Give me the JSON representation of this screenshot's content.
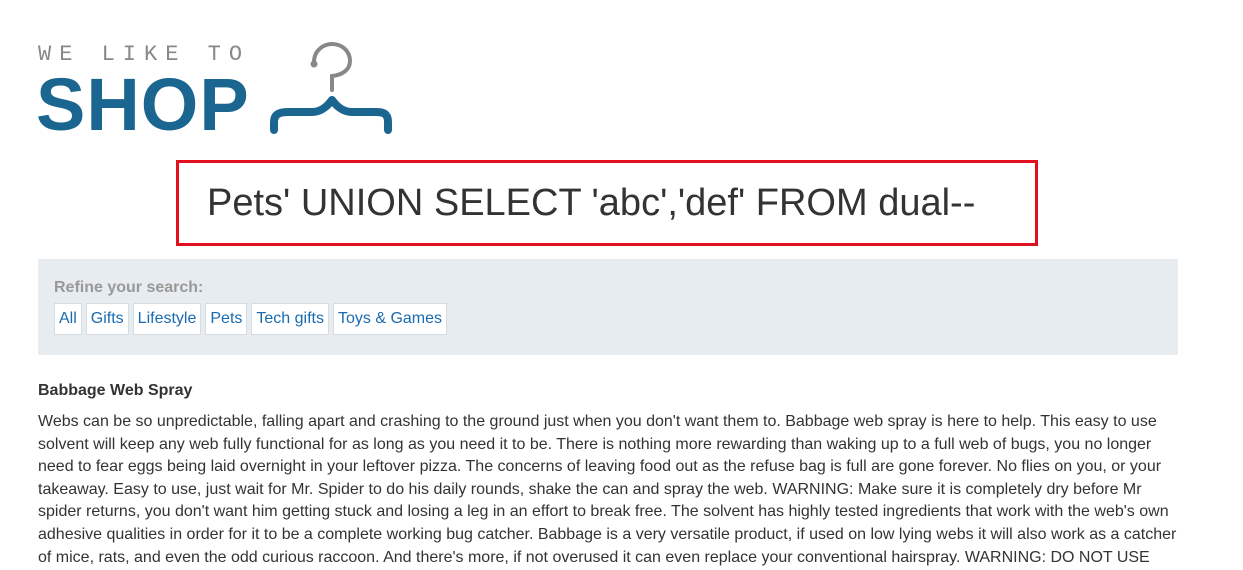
{
  "logo": {
    "tagline": "WE LIKE TO",
    "wordmark": "SHOP",
    "icon": "hanger-icon",
    "colors": {
      "primary": "#1a6690",
      "tagline": "#888888"
    }
  },
  "search": {
    "heading": "Pets' UNION SELECT 'abc','def' FROM dual--",
    "highlight_color": "#e0101f"
  },
  "filters": {
    "label": "Refine your search:",
    "categories": [
      "All",
      "Gifts",
      "Lifestyle",
      "Pets",
      "Tech gifts",
      "Toys & Games"
    ]
  },
  "product": {
    "name": "Babbage Web Spray",
    "description": "Webs can be so unpredictable, falling apart and crashing to the ground just when you don't want them to. Babbage web spray is here to help. This easy to use solvent will keep any web fully functional for as long as you need it to be. There is nothing more rewarding than waking up to a full web of bugs, you no longer need to fear eggs being laid overnight in your leftover pizza. The concerns of leaving food out as the refuse bag is full are gone forever. No flies on you, or your takeaway. Easy to use, just wait for Mr. Spider to do his daily rounds, shake the can and spray the web. WARNING: Make sure it is completely dry before Mr spider returns, you don't want him getting stuck and losing a leg in an effort to break free. The solvent has highly tested ingredients that work with the web's own adhesive qualities in order for it to be a complete working bug catcher. Babbage is a very versatile product, if used on low lying webs it will also work as a catcher of mice, rats, and even the odd curious raccoon. And there's more, if not overused it can even replace your conventional hairspray. WARNING: DO NOT USE"
  }
}
